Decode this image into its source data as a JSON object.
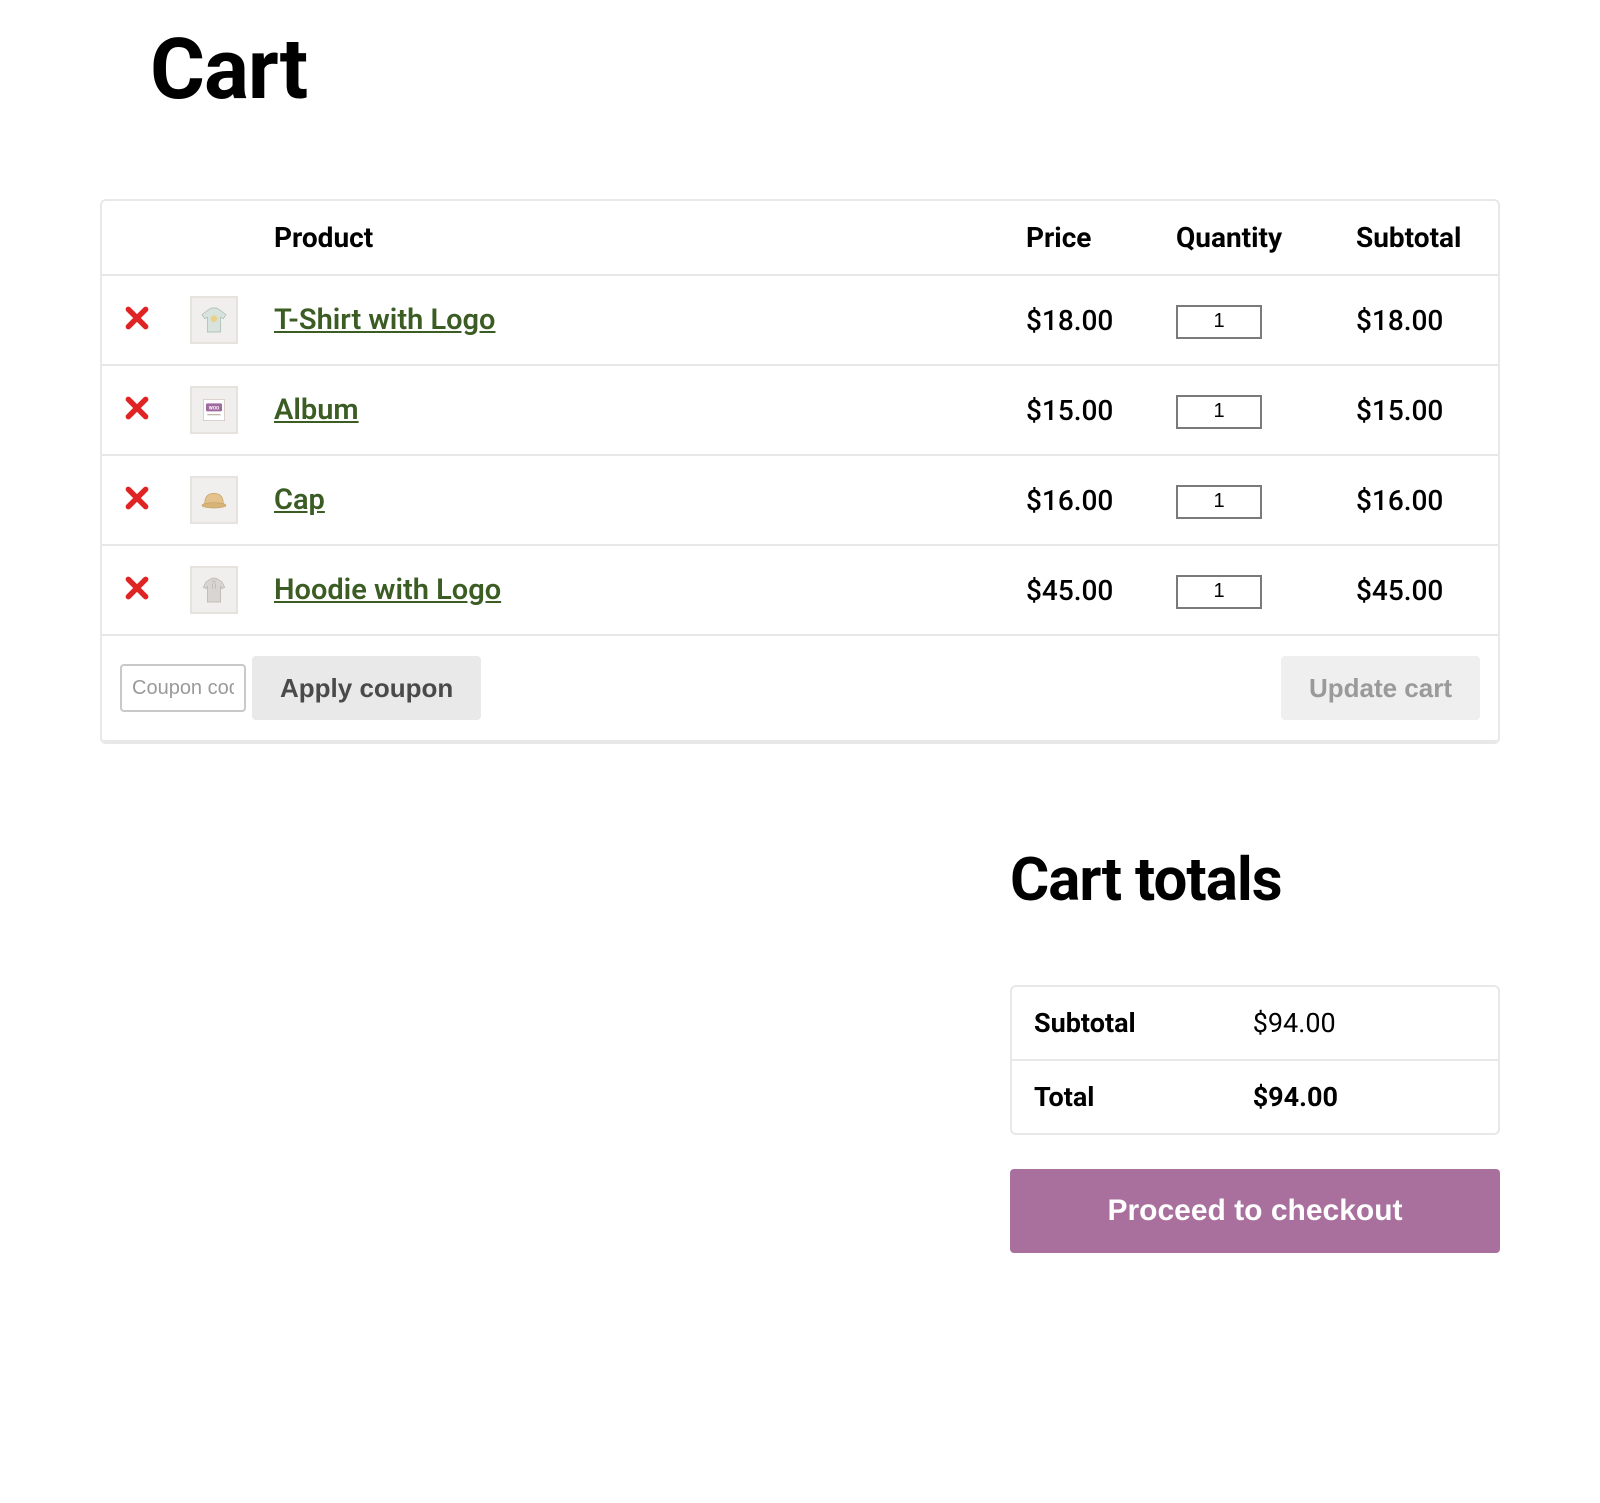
{
  "page": {
    "title": "Cart"
  },
  "table": {
    "headers": {
      "product": "Product",
      "price": "Price",
      "quantity": "Quantity",
      "subtotal": "Subtotal"
    },
    "items": [
      {
        "name": "T-Shirt with Logo",
        "price": "$18.00",
        "qty": "1",
        "subtotal": "$18.00",
        "icon": "tshirt"
      },
      {
        "name": "Album",
        "price": "$15.00",
        "qty": "1",
        "subtotal": "$15.00",
        "icon": "album"
      },
      {
        "name": "Cap",
        "price": "$16.00",
        "qty": "1",
        "subtotal": "$16.00",
        "icon": "cap"
      },
      {
        "name": "Hoodie with Logo",
        "price": "$45.00",
        "qty": "1",
        "subtotal": "$45.00",
        "icon": "hoodie"
      }
    ]
  },
  "actions": {
    "coupon_placeholder": "Coupon code",
    "apply_coupon": "Apply coupon",
    "update_cart": "Update cart"
  },
  "totals": {
    "title": "Cart totals",
    "subtotal_label": "Subtotal",
    "subtotal_value": "$94.00",
    "total_label": "Total",
    "total_value": "$94.00",
    "checkout": "Proceed to checkout"
  }
}
